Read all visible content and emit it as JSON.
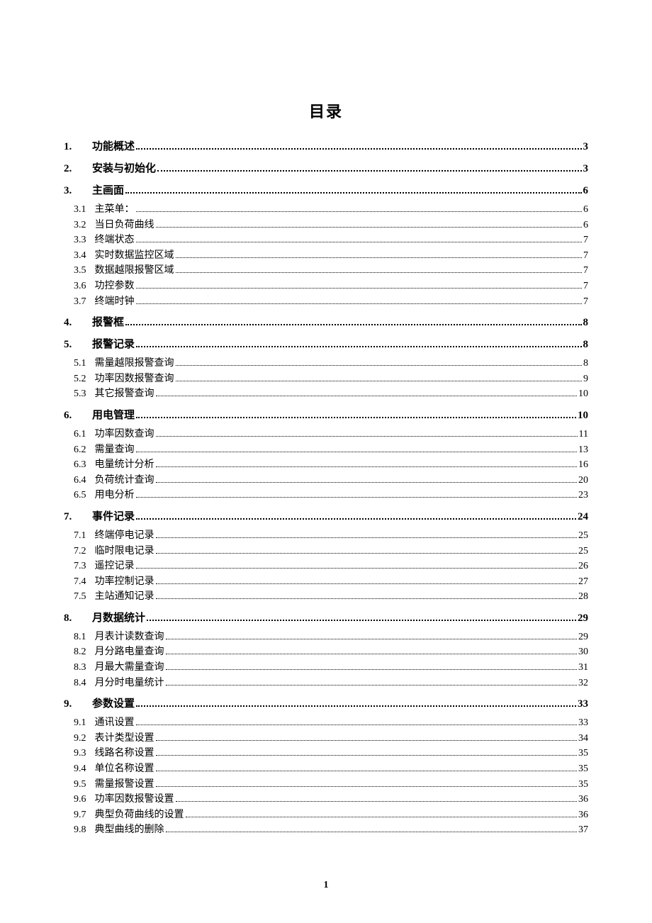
{
  "title": "目录",
  "page_number": "1",
  "sections": [
    {
      "num": "1.",
      "label": "功能概述",
      "page": "3",
      "level": 1
    },
    {
      "num": "2.",
      "label": "安装与初始化",
      "page": "3",
      "level": 1
    },
    {
      "num": "3.",
      "label": "主画面",
      "page": "6",
      "level": 1
    },
    {
      "num": "3.1",
      "label": "主菜单：",
      "page": "6",
      "level": 2
    },
    {
      "num": "3.2",
      "label": "当日负荷曲线",
      "page": "6",
      "level": 2
    },
    {
      "num": "3.3",
      "label": "终端状态",
      "page": "7",
      "level": 2
    },
    {
      "num": "3.4",
      "label": "实时数据监控区域",
      "page": "7",
      "level": 2
    },
    {
      "num": "3.5",
      "label": "数据越限报警区域",
      "page": "7",
      "level": 2
    },
    {
      "num": "3.6",
      "label": "功控参数",
      "page": "7",
      "level": 2
    },
    {
      "num": "3.7",
      "label": "终端时钟",
      "page": "7",
      "level": 2
    },
    {
      "num": "4.",
      "label": "报警框",
      "page": "8",
      "level": 1
    },
    {
      "num": "5.",
      "label": "报警记录",
      "page": "8",
      "level": 1
    },
    {
      "num": "5.1",
      "label": "需量越限报警查询",
      "page": "8",
      "level": 2
    },
    {
      "num": "5.2",
      "label": "功率因数报警查询",
      "page": "9",
      "level": 2
    },
    {
      "num": "5.3",
      "label": "其它报警查询",
      "page": "10",
      "level": 2
    },
    {
      "num": "6.",
      "label": "用电管理",
      "page": "10",
      "level": 1
    },
    {
      "num": "6.1",
      "label": "功率因数查询",
      "page": "11",
      "level": 2
    },
    {
      "num": "6.2",
      "label": "需量查询",
      "page": "13",
      "level": 2
    },
    {
      "num": "6.3",
      "label": "电量统计分析",
      "page": "16",
      "level": 2
    },
    {
      "num": "6.4",
      "label": "负荷统计查询",
      "page": "20",
      "level": 2
    },
    {
      "num": "6.5",
      "label": "用电分析",
      "page": "23",
      "level": 2
    },
    {
      "num": "7.",
      "label": "事件记录",
      "page": "24",
      "level": 1
    },
    {
      "num": "7.1",
      "label": "终端停电记录",
      "page": "25",
      "level": 2
    },
    {
      "num": "7.2",
      "label": "临时限电记录",
      "page": "25",
      "level": 2
    },
    {
      "num": "7.3",
      "label": "遥控记录",
      "page": "26",
      "level": 2
    },
    {
      "num": "7.4",
      "label": "功率控制记录",
      "page": "27",
      "level": 2
    },
    {
      "num": "7.5",
      "label": "主站通知记录",
      "page": "28",
      "level": 2
    },
    {
      "num": "8.",
      "label": "月数据统计",
      "page": "29",
      "level": 1
    },
    {
      "num": "8.1",
      "label": "月表计读数查询",
      "page": "29",
      "level": 2
    },
    {
      "num": "8.2",
      "label": "月分路电量查询",
      "page": "30",
      "level": 2
    },
    {
      "num": "8.3",
      "label": "月最大需量查询",
      "page": "31",
      "level": 2
    },
    {
      "num": "8.4",
      "label": "月分时电量统计",
      "page": "32",
      "level": 2
    },
    {
      "num": "9.",
      "label": "参数设置",
      "page": "33",
      "level": 1
    },
    {
      "num": "9.1",
      "label": "通讯设置",
      "page": "33",
      "level": 2
    },
    {
      "num": "9.2",
      "label": "表计类型设置",
      "page": "34",
      "level": 2
    },
    {
      "num": "9.3",
      "label": "线路名称设置",
      "page": "35",
      "level": 2
    },
    {
      "num": "9.4",
      "label": "单位名称设置",
      "page": "35",
      "level": 2
    },
    {
      "num": "9.5",
      "label": "需量报警设置",
      "page": "35",
      "level": 2
    },
    {
      "num": "9.6",
      "label": "功率因数报警设置",
      "page": "36",
      "level": 2
    },
    {
      "num": "9.7",
      "label": "典型负荷曲线的设置",
      "page": "36",
      "level": 2
    },
    {
      "num": "9.8",
      "label": "典型曲线的删除",
      "page": "37",
      "level": 2
    }
  ]
}
